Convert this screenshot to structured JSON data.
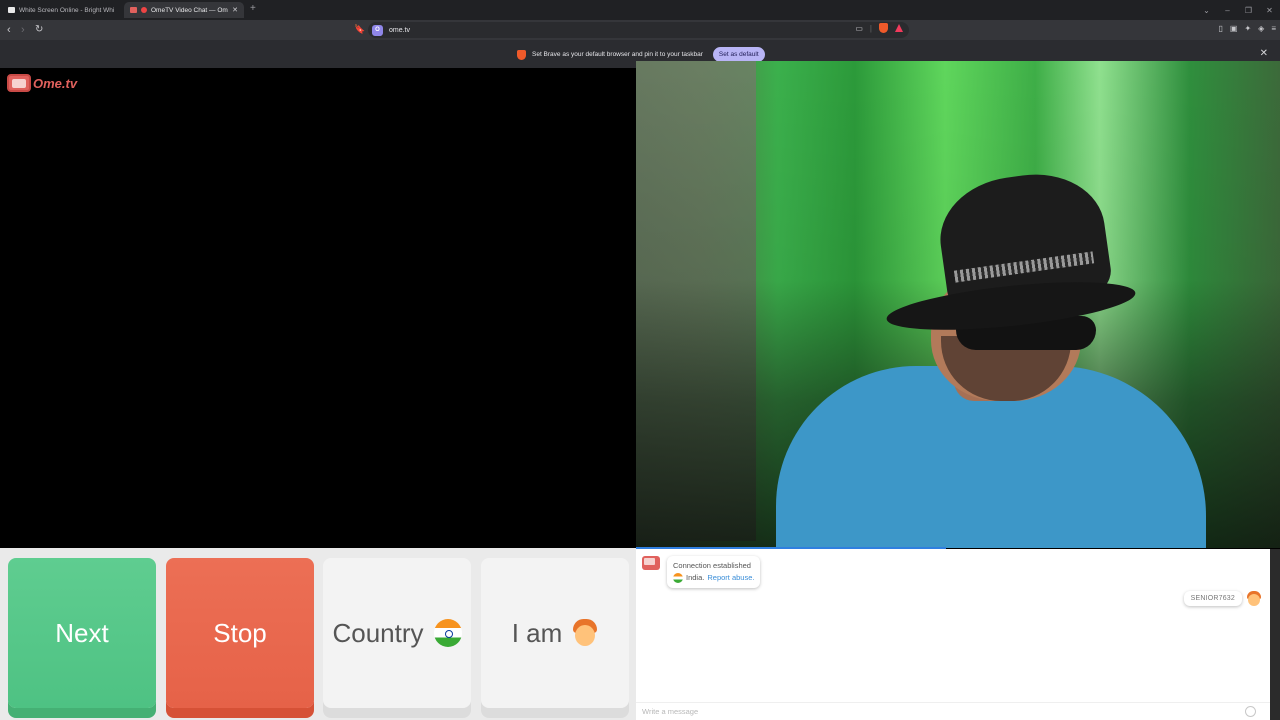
{
  "browser": {
    "tabs": [
      {
        "label": "White Screen Online - Bright White L",
        "active": false
      },
      {
        "label": "OmeTV Video Chat — Omeg",
        "active": true
      }
    ],
    "url": "ome.tv",
    "infobar": {
      "message": "Set Brave as your default browser and pin it to your taskbar",
      "button": "Set as default"
    }
  },
  "site": {
    "logo_text": "Ome.tv"
  },
  "controls": {
    "next_label": "Next",
    "stop_label": "Stop",
    "country_label": "Country",
    "iam_label": "I am"
  },
  "chat": {
    "status": "Connection established",
    "country": "India.",
    "report_link": "Report abuse.",
    "username": "SENIOR7632",
    "input_placeholder": "Write a message"
  },
  "colors": {
    "next": "#5fcd90",
    "stop": "#ec6f55",
    "accent": "#3b8ed8",
    "brand": "#e0615d"
  }
}
